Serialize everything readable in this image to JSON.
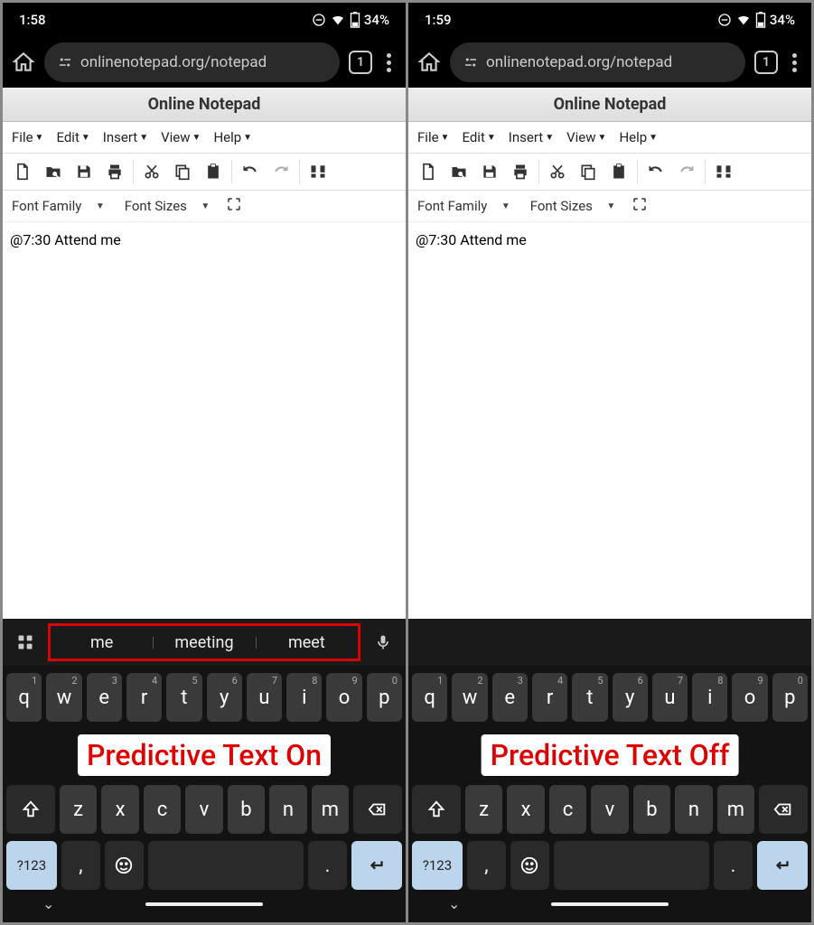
{
  "left": {
    "time": "1:58",
    "battery": "34%",
    "url": "onlinenotepad.org/notepad",
    "tabcount": "1",
    "apptitle": "Online Notepad",
    "menus": [
      "File",
      "Edit",
      "Insert",
      "View",
      "Help"
    ],
    "fontfamily": "Font Family",
    "fontsizes": "Font Sizes",
    "editor_text": "@7:30 Attend me",
    "suggestions": [
      "me",
      "meeting",
      "meet"
    ],
    "overlay": "Predictive Text On",
    "symkey": "?123"
  },
  "right": {
    "time": "1:59",
    "battery": "34%",
    "url": "onlinenotepad.org/notepad",
    "tabcount": "1",
    "apptitle": "Online Notepad",
    "menus": [
      "File",
      "Edit",
      "Insert",
      "View",
      "Help"
    ],
    "fontfamily": "Font Family",
    "fontsizes": "Font Sizes",
    "editor_text": "@7:30 Attend me",
    "overlay": "Predictive Text Off",
    "symkey": "?123"
  },
  "keys": {
    "row1": [
      {
        "k": "q",
        "n": "1"
      },
      {
        "k": "w",
        "n": "2"
      },
      {
        "k": "e",
        "n": "3"
      },
      {
        "k": "r",
        "n": "4"
      },
      {
        "k": "t",
        "n": "5"
      },
      {
        "k": "y",
        "n": "6"
      },
      {
        "k": "u",
        "n": "7"
      },
      {
        "k": "i",
        "n": "8"
      },
      {
        "k": "o",
        "n": "9"
      },
      {
        "k": "p",
        "n": "0"
      }
    ],
    "row3": [
      "z",
      "x",
      "c",
      "v",
      "b",
      "n",
      "m"
    ]
  }
}
